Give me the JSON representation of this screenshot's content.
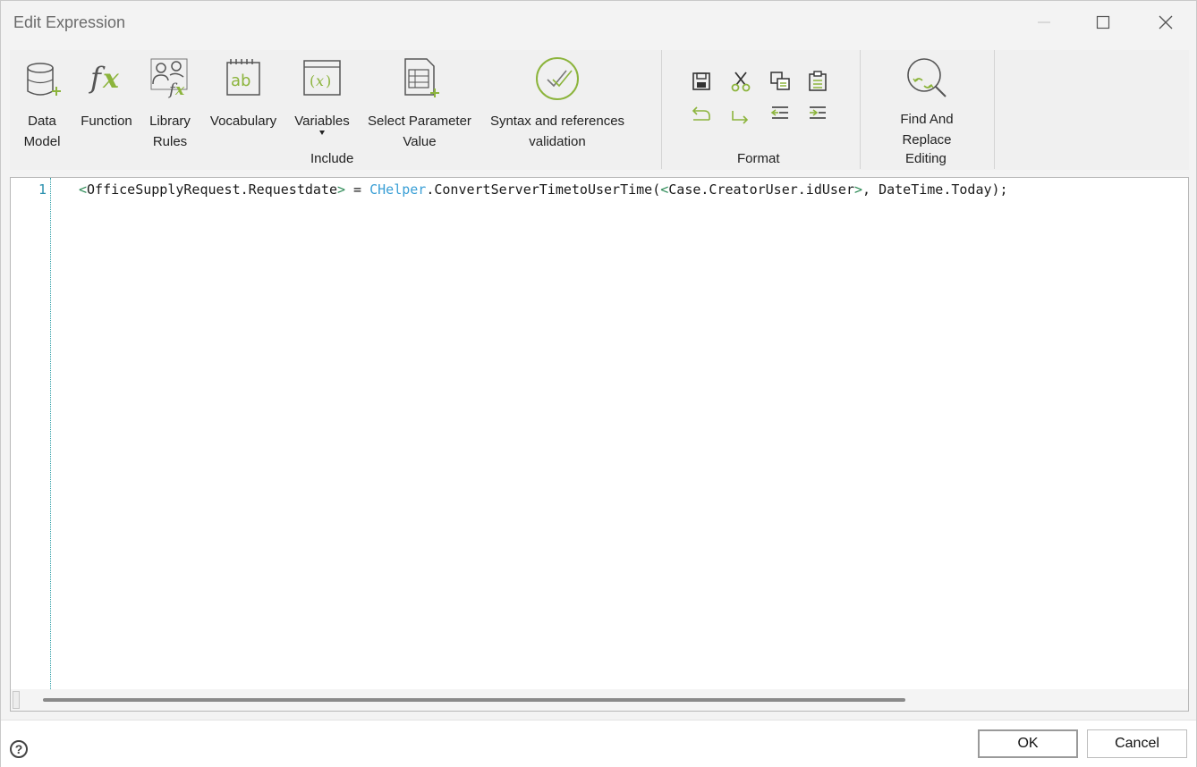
{
  "window": {
    "title": "Edit Expression"
  },
  "ribbon": {
    "include": {
      "label": "Include",
      "tools": {
        "data_model": "Data\nModel",
        "function": "Function",
        "library_rules": "Library\nRules",
        "vocabulary": "Vocabulary",
        "variables": "Variables",
        "select_parameter_value": "Select Parameter\nValue",
        "syntax_validation": "Syntax and references\nvalidation"
      }
    },
    "format": {
      "label": "Format",
      "icons": [
        "save-icon",
        "cut-icon",
        "copy-icon",
        "paste-icon",
        "undo-icon",
        "redo-icon",
        "outdent-icon",
        "indent-icon"
      ]
    },
    "editing": {
      "label": "Editing",
      "find_replace": "Find And\nReplace"
    }
  },
  "editor": {
    "line_number": "1",
    "code": {
      "t1": "<",
      "t2": "OfficeSupplyRequest.Requestdate",
      "t3": ">",
      "t4": " = ",
      "t5": "CHelper",
      "t6": ".ConvertServerTimetoUserTime(",
      "t7": "<",
      "t8": "Case.CreatorUser.idUser",
      "t9": ">",
      "t10": ", DateTime.Today);"
    }
  },
  "footer": {
    "help_symbol": "?",
    "ok_label": "OK",
    "cancel_label": "Cancel"
  },
  "colors": {
    "accent_green": "#8cb43c",
    "icon_gray": "#555555",
    "code_class": "#3a9fd6",
    "code_tag": "#2e8b57"
  }
}
